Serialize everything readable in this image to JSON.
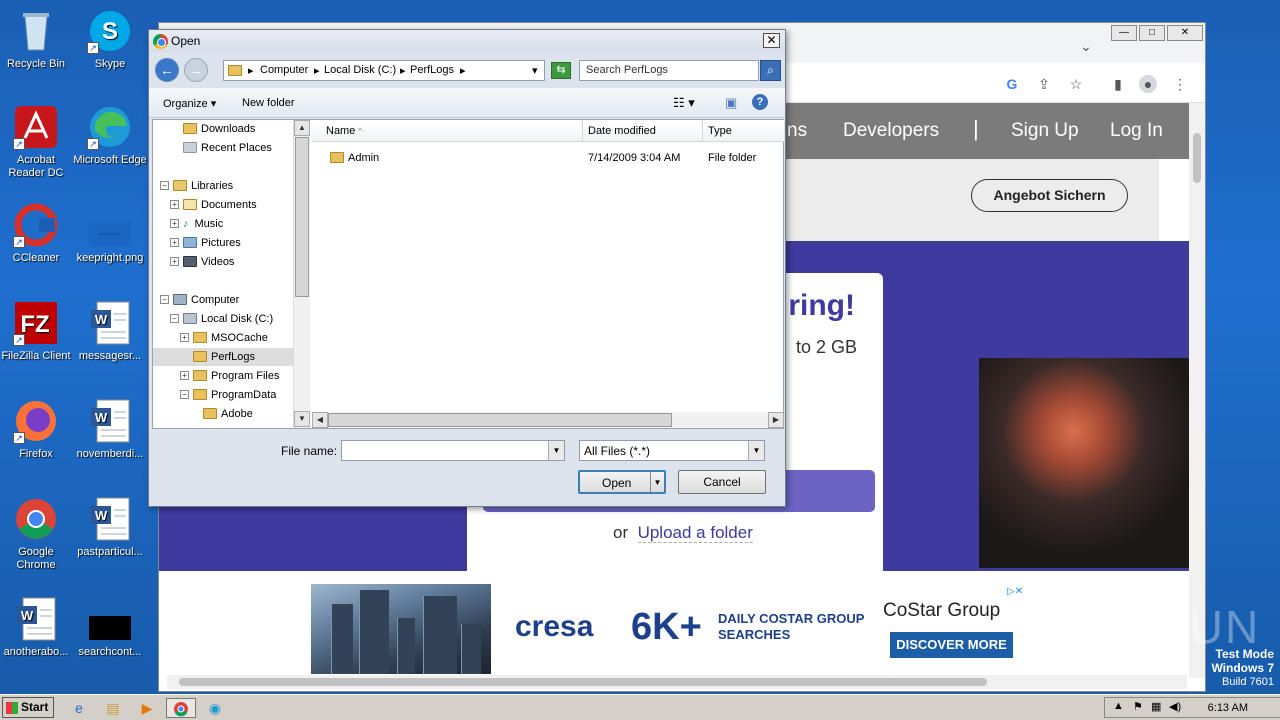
{
  "desktop": {
    "icons": [
      {
        "label": "Recycle Bin",
        "icon": "recycle-bin-icon"
      },
      {
        "label": "Skype",
        "icon": "skype-icon"
      },
      {
        "label": "Acrobat Reader DC",
        "icon": "acrobat-icon"
      },
      {
        "label": "Microsoft Edge",
        "icon": "edge-icon"
      },
      {
        "label": "CCleaner",
        "icon": "ccleaner-icon"
      },
      {
        "label": "keepright.png",
        "icon": "image-file-icon"
      },
      {
        "label": "FileZilla Client",
        "icon": "filezilla-icon"
      },
      {
        "label": "messagesr...",
        "icon": "word-doc-icon"
      },
      {
        "label": "Firefox",
        "icon": "firefox-icon"
      },
      {
        "label": "novemberdi...",
        "icon": "word-doc-icon"
      },
      {
        "label": "Google Chrome",
        "icon": "chrome-icon"
      },
      {
        "label": "pastparticul...",
        "icon": "word-doc-icon"
      },
      {
        "label": "anotherabo...",
        "icon": "word-doc-icon"
      },
      {
        "label": "searchcont...",
        "icon": "black-file-icon"
      }
    ]
  },
  "browser": {
    "nav": {
      "link1": "ns",
      "developers": "Developers",
      "signup": "Sign Up",
      "login": "Log In"
    },
    "cta": "Angebot Sichern",
    "card": {
      "title": "ring!",
      "subtitle": "to 2 GB",
      "or": "or",
      "upload_folder": "Upload a folder"
    },
    "ad": {
      "brand": "cresa",
      "big": "6K+",
      "daily_line1": "DAILY COSTAR GROUP",
      "daily_line2": "SEARCHES",
      "costar": "CoStar Group",
      "discover": "DISCOVER MORE"
    }
  },
  "dialog": {
    "title": "Open",
    "close": "✕",
    "breadcrumbs": [
      "Computer",
      "Local Disk (C:)",
      "PerfLogs"
    ],
    "search_placeholder": "Search PerfLogs",
    "toolbar": {
      "organize": "Organize",
      "new_folder": "New folder"
    },
    "tree": [
      {
        "label": "Downloads",
        "indent": 1
      },
      {
        "label": "Recent Places",
        "indent": 1
      },
      {
        "label": "Libraries",
        "indent": 0
      },
      {
        "label": "Documents",
        "indent": 1
      },
      {
        "label": "Music",
        "indent": 1
      },
      {
        "label": "Pictures",
        "indent": 1
      },
      {
        "label": "Videos",
        "indent": 1
      },
      {
        "label": "Computer",
        "indent": 0
      },
      {
        "label": "Local Disk (C:)",
        "indent": 1
      },
      {
        "label": "MSOCache",
        "indent": 2
      },
      {
        "label": "PerfLogs",
        "indent": 2,
        "selected": true
      },
      {
        "label": "Program Files",
        "indent": 2
      },
      {
        "label": "ProgramData",
        "indent": 2
      },
      {
        "label": "Adobe",
        "indent": 3
      }
    ],
    "columns": {
      "name": "Name",
      "date": "Date modified",
      "type": "Type"
    },
    "files": [
      {
        "name": "Admin",
        "date": "7/14/2009 3:04 AM",
        "type": "File folder"
      }
    ],
    "file_name_label": "File name:",
    "file_name_value": "",
    "filter": "All Files (*.*)",
    "open_btn": "Open",
    "cancel_btn": "Cancel"
  },
  "watermark": {
    "anyrun": "ANY RUN",
    "test_mode": "Test Mode",
    "windows": "Windows 7",
    "build": "Build 7601"
  },
  "taskbar": {
    "start": "Start",
    "clock": "6:13 AM"
  }
}
